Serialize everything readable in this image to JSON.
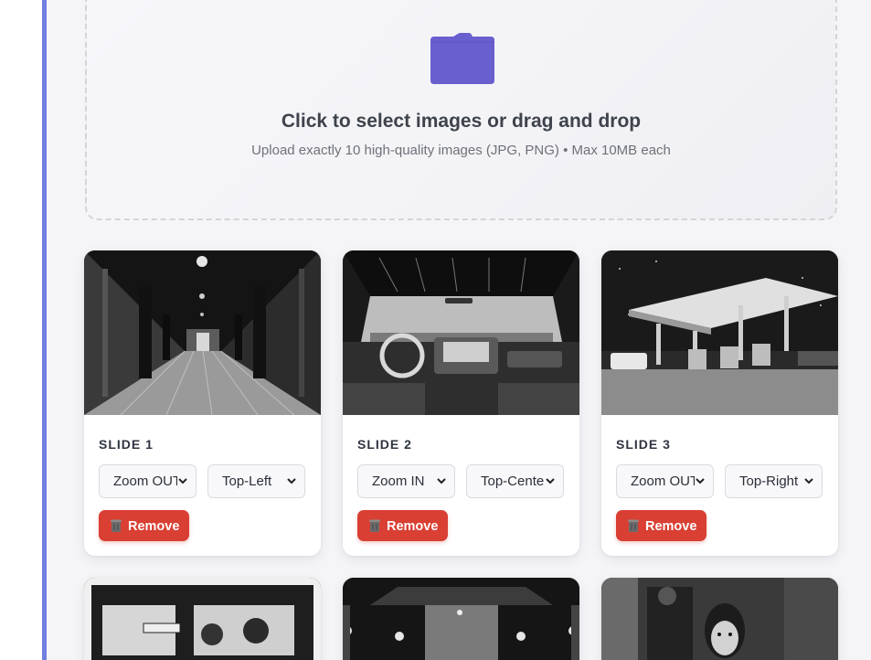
{
  "upload": {
    "title": "Click to select images or drag and drop",
    "subtitle": "Upload exactly 10 high-quality images (JPG, PNG) • Max 10MB each",
    "icon": "folder-icon"
  },
  "colors": {
    "accent": "#6f7fe0",
    "folder": "#6a5fcf",
    "remove": "#d93f33"
  },
  "slides": [
    {
      "label": "SLIDE 1",
      "zoom": "Zoom OUT",
      "position": "Top-Left",
      "remove_label": "Remove",
      "image": "hallway-illustration"
    },
    {
      "label": "SLIDE 2",
      "zoom": "Zoom IN",
      "position": "Top-Center",
      "remove_label": "Remove",
      "image": "car-interior-illustration"
    },
    {
      "label": "SLIDE 3",
      "zoom": "Zoom OUT",
      "position": "Top-Right",
      "remove_label": "Remove",
      "image": "gas-station-illustration"
    }
  ],
  "more_slides": [
    {
      "image": "bus-interior-illustration"
    },
    {
      "image": "lantern-pavilion-illustration"
    },
    {
      "image": "girl-portrait-illustration"
    }
  ]
}
